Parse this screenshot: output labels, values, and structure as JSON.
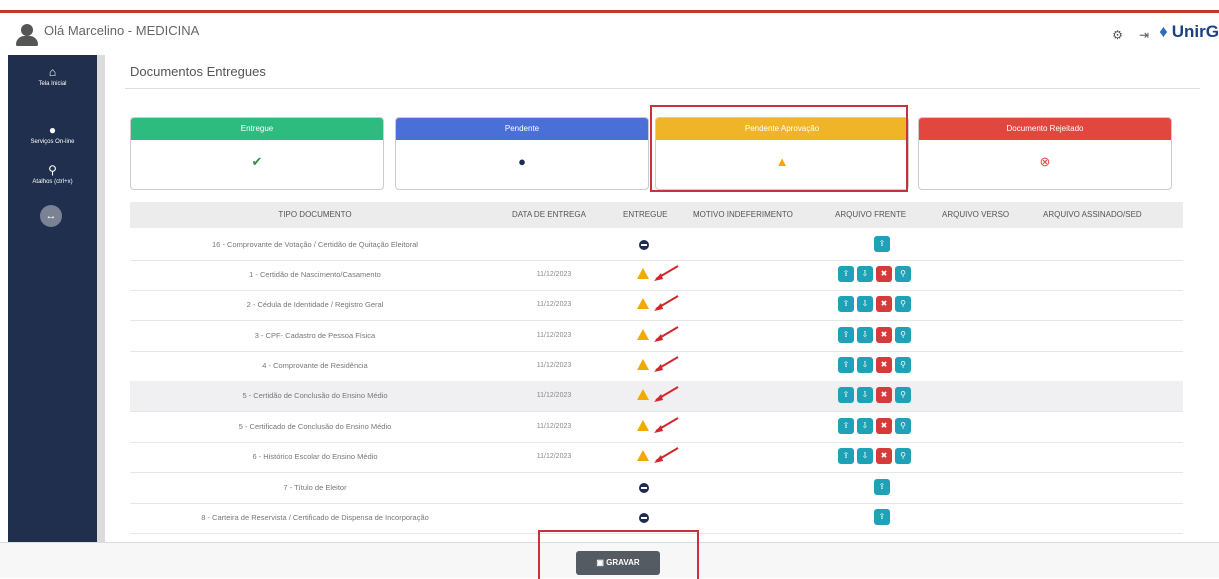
{
  "header": {
    "greeting": "Olá Marcelino - MEDICINA",
    "logo_text": "UnirG",
    "icons": [
      "settings-icon",
      "logout-icon"
    ]
  },
  "sidebar": {
    "items": [
      {
        "label": "Tela Inicial",
        "icon": "home-icon"
      },
      {
        "label": "Serviços On-line",
        "icon": "globe-icon"
      },
      {
        "label": "Atalhos (ctrl+x)",
        "icon": "shortcut-icon"
      }
    ],
    "toggle_label": "↔"
  },
  "page": {
    "title": "Documentos Entregues"
  },
  "status_cards": [
    {
      "label": "Entregue",
      "symbol": "✔",
      "color": "#2dbb7f",
      "symbol_color": "#2f8f4e"
    },
    {
      "label": "Pendente",
      "symbol": "●",
      "color": "#4a6fd7",
      "symbol_color": "#1f2c52"
    },
    {
      "label": "Pendente Aprovação",
      "symbol": "▲",
      "color": "#f0b429",
      "symbol_color": "#f2a900"
    },
    {
      "label": "Documento Rejeitado",
      "symbol": "⊗",
      "color": "#e2473f",
      "symbol_color": "#e2473f"
    }
  ],
  "table": {
    "headers": {
      "tipo": "TIPO DOCUMENTO",
      "data": "DATA DE ENTREGA",
      "entregue": "ENTREGUE",
      "motivo": "MOTIVO INDEFERIMENTO",
      "frente": "ARQUIVO FRENTE",
      "verso": "ARQUIVO VERSO",
      "assinado": "ARQUIVO ASSINADO/SED"
    },
    "rows": [
      {
        "tipo": "16 - Comprovante de Votação / Certidão de Quitação Eleitoral",
        "data": "",
        "status": "pending"
      },
      {
        "tipo": "1 - Certidão de Nascimento/Casamento",
        "data": "11/12/2023",
        "status": "awaiting"
      },
      {
        "tipo": "2 - Cédula de Identidade / Registro Geral",
        "data": "11/12/2023",
        "status": "awaiting"
      },
      {
        "tipo": "3 - CPF- Cadastro de Pessoa Física",
        "data": "11/12/2023",
        "status": "awaiting"
      },
      {
        "tipo": "4 - Comprovante de Residência",
        "data": "11/12/2023",
        "status": "awaiting"
      },
      {
        "tipo": "5 - Certidão de Conclusão do Ensino Médio",
        "data": "11/12/2023",
        "status": "awaiting"
      },
      {
        "tipo": "5 - Certificado de Conclusão do Ensino Médio",
        "data": "11/12/2023",
        "status": "awaiting"
      },
      {
        "tipo": "6 - Histórico Escolar do Ensino Médio",
        "data": "11/12/2023",
        "status": "awaiting"
      },
      {
        "tipo": "7 - Título de Eleitor",
        "data": "",
        "status": "pending"
      },
      {
        "tipo": "8 - Carteira de Reservista / Certificado de Dispensa de Incorporação",
        "data": "",
        "status": "pending"
      }
    ]
  },
  "footer": {
    "save_label": "GRAVAR",
    "save_icon": "floppy-icon"
  }
}
